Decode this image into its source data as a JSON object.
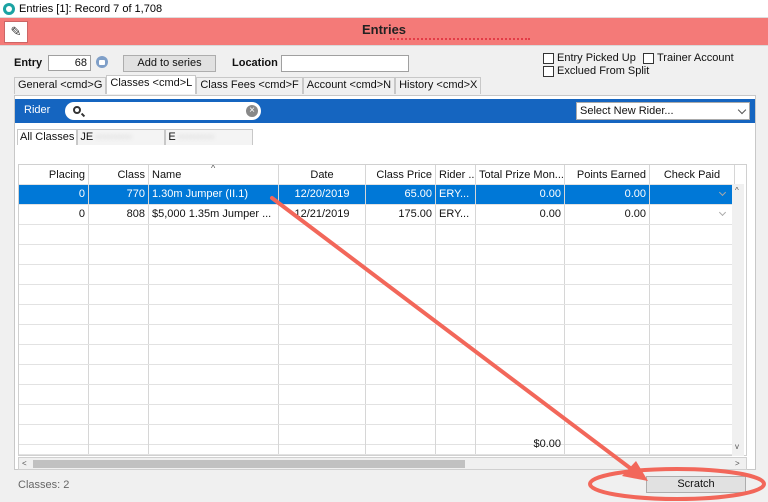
{
  "window": {
    "title": "Entries [1]: Record 7 of 1,708"
  },
  "banner": {
    "title": "Entries",
    "logo_glyph": "✎"
  },
  "form": {
    "entry_label": "Entry",
    "entry_value": "68",
    "add_series_label": "Add to series",
    "location_label": "Location",
    "location_value": ""
  },
  "checkboxes": {
    "entry_picked_up": "Entry Picked Up",
    "trainer_account": "Trainer Account",
    "excluded_from_split": "Exclued From Split"
  },
  "tabs": [
    {
      "label": "General <cmd>G"
    },
    {
      "label": "Classes <cmd>L"
    },
    {
      "label": "Class Fees <cmd>F"
    },
    {
      "label": "Account <cmd>N"
    },
    {
      "label": "History <cmd>X"
    }
  ],
  "rider": {
    "label": "Rider",
    "search_placeholder": "",
    "clear_glyph": "×",
    "select_value": "Select New Rider..."
  },
  "subtabs": [
    {
      "label": "All Classes"
    },
    {
      "label": "JE"
    },
    {
      "label": "E"
    }
  ],
  "grid": {
    "columns": [
      "Placing",
      "Class",
      "Name",
      "Date",
      "Class Price",
      "Rider ...",
      "Total Prize Mon...",
      "Points Earned",
      "Check Paid"
    ],
    "rows": [
      {
        "placing": "0",
        "class": "770",
        "name": "1.30m Jumper (II.1)",
        "date": "12/20/2019",
        "price": "65.00",
        "rider": "ERY...",
        "prize": "0.00",
        "points": "0.00"
      },
      {
        "placing": "0",
        "class": "808",
        "name": "$5,000 1.35m Jumper ...",
        "date": "12/21/2019",
        "price": "175.00",
        "rider": "ERY...",
        "prize": "0.00",
        "points": "0.00"
      }
    ],
    "total_prize": "$0.00"
  },
  "footer": {
    "classes_count": "Classes: 2",
    "scratch_label": "Scratch"
  },
  "colors": {
    "banner": "#f47a78",
    "rider_bar": "#1565c0",
    "selection": "#0078d7",
    "annotation": "#f2675a"
  }
}
